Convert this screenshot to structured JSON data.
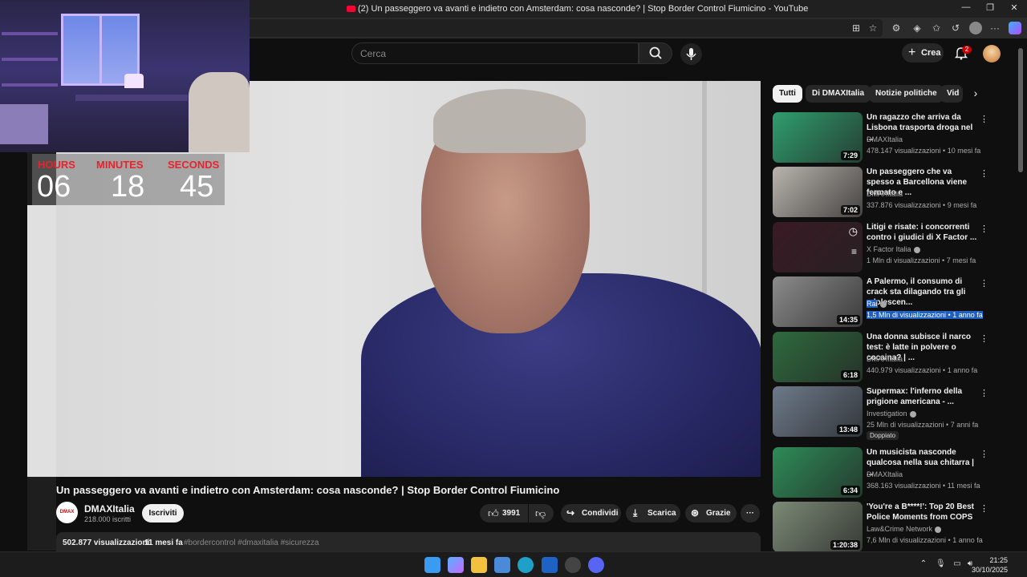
{
  "window": {
    "title": "(2) Un passeggero va avanti e indietro con Amsterdam: cosa nasconde? | Stop Border Control Fiumicino - YouTube"
  },
  "overlay": {
    "hours_label": "HOURS",
    "hours": "06",
    "minutes_label": "MINUTES",
    "minutes": "18",
    "seconds_label": "SECONDS",
    "seconds": "45"
  },
  "header": {
    "search_placeholder": "Cerca",
    "create_label": "Crea",
    "notif_count": "2"
  },
  "video": {
    "title": "Un passeggero va avanti e indietro con Amsterdam: cosa nasconde? | Stop Border Control Fiumicino",
    "channel_logo": "DMAX",
    "channel": "DMAXItalia",
    "subscribers": "218.000 iscritti",
    "subscribe_label": "Iscriviti",
    "likes": "3991",
    "share_label": "Condividi",
    "download_label": "Scarica",
    "thanks_label": "Grazie",
    "views": "502.877 visualizzazioni",
    "age": "11 mesi fa",
    "hashtags": "#bordercontrol #dmaxitalia #sicurezza"
  },
  "chips": [
    "Tutti",
    "Di DMAXItalia",
    "Notizie politiche",
    "Vid"
  ],
  "recommendations": [
    {
      "title": "Un ragazzo che arriva da Lisbona trasporta droga nel ...",
      "channel": "DMAXItalia",
      "meta": "478.147 visualizzazioni • 10 mesi fa",
      "duration": "7:29",
      "thumb": "#2f9e6e"
    },
    {
      "title": "Un passeggero che va spesso a Barcellona viene fermato e ...",
      "channel": "DMAXItalia",
      "meta": "337.876 visualizzazioni • 9 mesi fa",
      "duration": "7:02",
      "thumb": "#b9b4ad"
    },
    {
      "title": "Litigi e risate: i concorrenti contro i giudici di X Factor ...",
      "channel": "X Factor Italia",
      "meta": "1 Mln di visualizzazioni • 7 mesi fa",
      "duration": "",
      "thumb": "#3a1a24"
    },
    {
      "title": "A Palermo, il consumo di crack sta dilagando tra gli adolescen...",
      "channel": "Rai",
      "meta": "1,5 Mln di visualizzazioni • 1 anno fa",
      "duration": "14:35",
      "thumb": "#8c8c8c"
    },
    {
      "title": "Una donna subisce il narco test: è latte in polvere o cocaina? | ...",
      "channel": "DMAXItalia",
      "meta": "440.979 visualizzazioni • 1 anno fa",
      "duration": "6:18",
      "thumb": "#2f6a3e"
    },
    {
      "title": "Supermax: l'inferno della prigione americana - ...",
      "channel": "Investigation",
      "meta": "25 Mln di visualizzazioni • 7 anni fa",
      "duration": "13:48",
      "thumb": "#6d7a8a",
      "badge": "Doppiato"
    },
    {
      "title": "Un musicista nasconde qualcosa nella sua chitarra | ...",
      "channel": "DMAXItalia",
      "meta": "368.163 visualizzazioni • 11 mesi fa",
      "duration": "6:34",
      "thumb": "#2e8b57"
    },
    {
      "title": "'You're a B****!': Top 20 Best Police Moments from COPS",
      "channel": "Law&Crime Network",
      "meta": "7,6 Mln di visualizzazioni • 1 anno fa",
      "duration": "1:20:38",
      "thumb": "#7c8a76"
    }
  ],
  "taskbar": {
    "time": "21:25",
    "date": "30/10/2025"
  },
  "colors": {
    "accent": "#ff0033",
    "background": "#0f0f0f",
    "surface": "#272727"
  }
}
